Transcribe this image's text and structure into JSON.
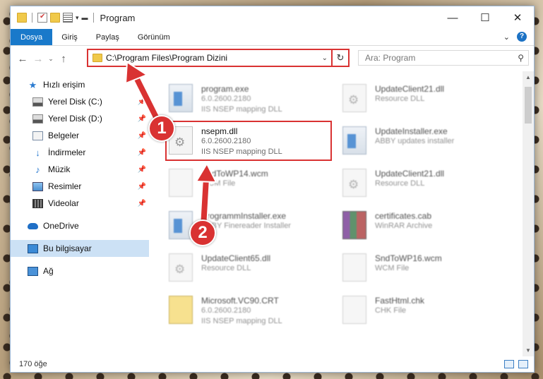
{
  "window": {
    "title": "Program",
    "controls": {
      "minimize": "—",
      "maximize": "☐",
      "close": "✕"
    }
  },
  "ribbon": {
    "tabs": [
      {
        "label": "Dosya"
      },
      {
        "label": "Giriş"
      },
      {
        "label": "Paylaş"
      },
      {
        "label": "Görünüm"
      }
    ]
  },
  "address": {
    "path": "C:\\Program Files\\Program Dizini",
    "search_placeholder": "Ara: Program"
  },
  "sidebar": {
    "quick_access": "Hızlı erişim",
    "items": [
      {
        "label": "Yerel Disk (C:)",
        "icon": "drive-icon",
        "pinned": true
      },
      {
        "label": "Yerel Disk (D:)",
        "icon": "drive-icon",
        "pinned": true
      },
      {
        "label": "Belgeler",
        "icon": "documents-icon",
        "pinned": true
      },
      {
        "label": "İndirmeler",
        "icon": "downloads-icon",
        "pinned": true
      },
      {
        "label": "Müzik",
        "icon": "music-icon",
        "pinned": true
      },
      {
        "label": "Resimler",
        "icon": "pictures-icon",
        "pinned": true
      },
      {
        "label": "Videolar",
        "icon": "videos-icon",
        "pinned": true
      }
    ],
    "onedrive": "OneDrive",
    "this_pc": "Bu bilgisayar",
    "network": "Ağ"
  },
  "files": [
    {
      "name": "program.exe",
      "line1": "6.0.2600.2180",
      "line2": "IIS NSEP mapping DLL",
      "icon": "exe-icon"
    },
    {
      "name": "UpdateClient21.dll",
      "line1": "Resource DLL",
      "line2": "",
      "icon": "dll-icon"
    },
    {
      "name": "nsepm.dll",
      "line1": "6.0.2600.2180",
      "line2": "IIS NSEP mapping DLL",
      "icon": "dll-icon"
    },
    {
      "name": "UpdateInstaller.exe",
      "line1": "ABBY updates installer",
      "line2": "",
      "icon": "exe-icon"
    },
    {
      "name": "SndToWP14.wcm",
      "line1": "WCM File",
      "line2": "",
      "icon": "document-icon"
    },
    {
      "name": "UpdateClient21.dll",
      "line1": "Resource DLL",
      "line2": "",
      "icon": "dll-icon"
    },
    {
      "name": "ProgrammInstaller.exe",
      "line1": "ABBY Finereader Installer",
      "line2": "",
      "icon": "exe-icon"
    },
    {
      "name": "certificates.cab",
      "line1": "WinRAR Archive",
      "line2": "",
      "icon": "archive-icon"
    },
    {
      "name": "UpdateClient65.dll",
      "line1": "Resource DLL",
      "line2": "",
      "icon": "dll-icon"
    },
    {
      "name": "SndToWP16.wcm",
      "line1": "WCM File",
      "line2": "",
      "icon": "document-icon"
    },
    {
      "name": "Microsoft.VC90.CRT",
      "line1": "6.0.2600.2180",
      "line2": "IIS NSEP mapping DLL",
      "icon": "cab-icon"
    },
    {
      "name": "FastHtml.chk",
      "line1": "CHK File",
      "line2": "",
      "icon": "document-icon"
    }
  ],
  "status": {
    "count": "170 öğe"
  },
  "annotations": {
    "step1": "1",
    "step2": "2"
  },
  "colors": {
    "accent": "#1979ca",
    "highlight": "#d93232",
    "selection": "#cce1f5"
  }
}
